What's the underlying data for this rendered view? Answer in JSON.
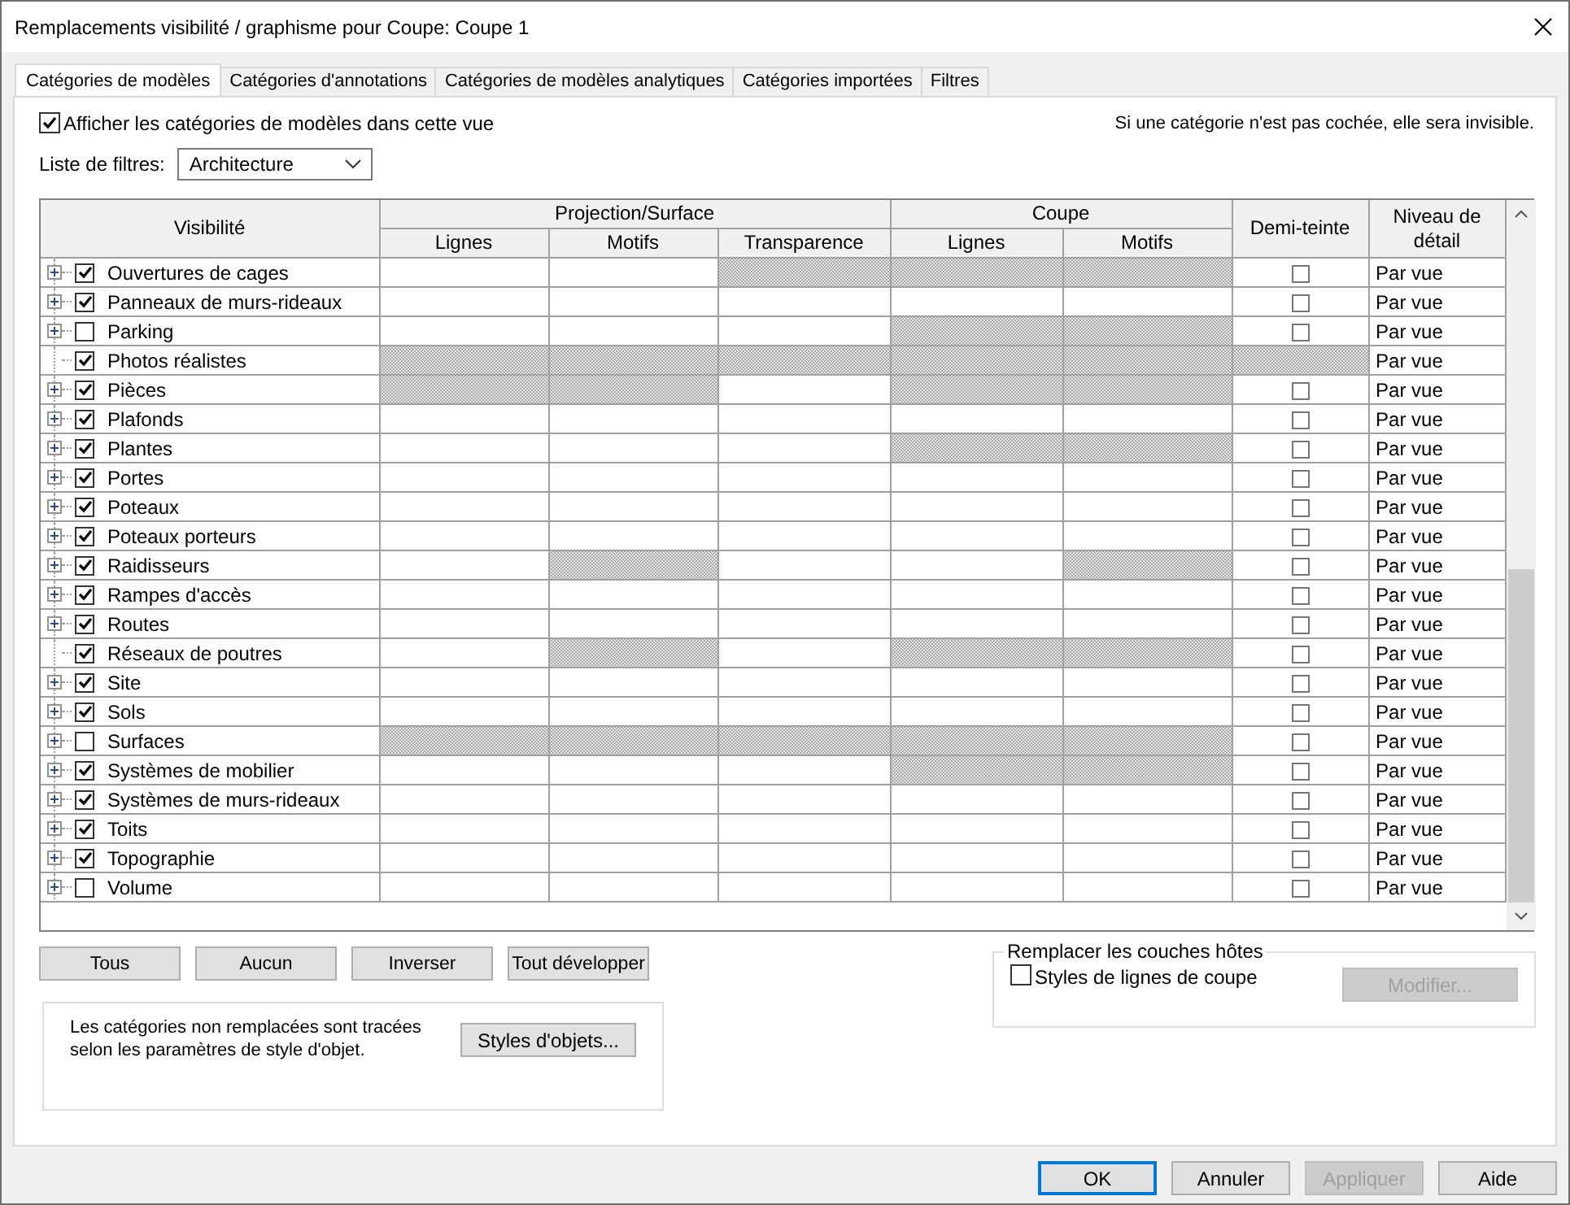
{
  "window": {
    "title": "Remplacements visibilité / graphisme pour Coupe: Coupe 1"
  },
  "tabs": [
    {
      "label": "Catégories de modèles",
      "selected": true
    },
    {
      "label": "Catégories d'annotations",
      "selected": false
    },
    {
      "label": "Catégories de modèles analytiques",
      "selected": false
    },
    {
      "label": "Catégories importées",
      "selected": false
    },
    {
      "label": "Filtres",
      "selected": false
    }
  ],
  "show_categories": {
    "label": "Afficher les catégories de modèles dans cette vue",
    "checked": true
  },
  "hint": "Si une catégorie n'est pas cochée, elle sera invisible.",
  "filter_list": {
    "label": "Liste de filtres:",
    "value": "Architecture"
  },
  "table": {
    "visibility_header": "Visibilité",
    "groups": [
      {
        "label": "Projection/Surface",
        "columns": [
          "Lignes",
          "Motifs",
          "Transparence"
        ]
      },
      {
        "label": "Coupe",
        "columns": [
          "Lignes",
          "Motifs"
        ]
      }
    ],
    "halftone_header": "Demi-teinte",
    "detail_header": "Niveau de détail",
    "rows": [
      {
        "name": "Ouvertures de cages",
        "expanded": false,
        "visible": true,
        "hatched": [
          false,
          false,
          true,
          true,
          true,
          false
        ],
        "halftone": false,
        "detail": "Par vue"
      },
      {
        "name": "Panneaux de murs-rideaux",
        "expanded": false,
        "visible": true,
        "hatched": [
          false,
          false,
          false,
          false,
          false,
          false
        ],
        "halftone": false,
        "detail": "Par vue"
      },
      {
        "name": "Parking",
        "expanded": false,
        "visible": false,
        "hatched": [
          false,
          false,
          false,
          true,
          true,
          false
        ],
        "halftone": false,
        "detail": "Par vue"
      },
      {
        "name": "Photos réalistes",
        "visible": true,
        "hatched": [
          true,
          true,
          true,
          true,
          true,
          true
        ],
        "detail": "Par vue"
      },
      {
        "name": "Pièces",
        "expanded": false,
        "visible": true,
        "hatched": [
          true,
          true,
          false,
          true,
          true,
          false
        ],
        "halftone": false,
        "detail": "Par vue"
      },
      {
        "name": "Plafonds",
        "expanded": false,
        "visible": true,
        "hatched": [
          false,
          false,
          false,
          false,
          false,
          false
        ],
        "halftone": false,
        "detail": "Par vue"
      },
      {
        "name": "Plantes",
        "expanded": false,
        "visible": true,
        "hatched": [
          false,
          false,
          false,
          true,
          true,
          false
        ],
        "halftone": false,
        "detail": "Par vue"
      },
      {
        "name": "Portes",
        "expanded": false,
        "visible": true,
        "hatched": [
          false,
          false,
          false,
          false,
          false,
          false
        ],
        "halftone": false,
        "detail": "Par vue"
      },
      {
        "name": "Poteaux",
        "expanded": false,
        "visible": true,
        "hatched": [
          false,
          false,
          false,
          false,
          false,
          false
        ],
        "halftone": false,
        "detail": "Par vue"
      },
      {
        "name": "Poteaux porteurs",
        "expanded": false,
        "visible": true,
        "hatched": [
          false,
          false,
          false,
          false,
          false,
          false
        ],
        "halftone": false,
        "detail": "Par vue"
      },
      {
        "name": "Raidisseurs",
        "expanded": false,
        "visible": true,
        "hatched": [
          false,
          true,
          false,
          false,
          true,
          false
        ],
        "halftone": false,
        "detail": "Par vue"
      },
      {
        "name": "Rampes d'accès",
        "expanded": false,
        "visible": true,
        "hatched": [
          false,
          false,
          false,
          false,
          false,
          false
        ],
        "halftone": false,
        "detail": "Par vue"
      },
      {
        "name": "Routes",
        "expanded": false,
        "visible": true,
        "hatched": [
          false,
          false,
          false,
          false,
          false,
          false
        ],
        "halftone": false,
        "detail": "Par vue"
      },
      {
        "name": "Réseaux de poutres",
        "visible": true,
        "hatched": [
          false,
          true,
          false,
          true,
          true,
          false
        ],
        "halftone": false,
        "detail": "Par vue"
      },
      {
        "name": "Site",
        "expanded": false,
        "visible": true,
        "hatched": [
          false,
          false,
          false,
          false,
          false,
          false
        ],
        "halftone": false,
        "detail": "Par vue"
      },
      {
        "name": "Sols",
        "expanded": false,
        "visible": true,
        "hatched": [
          false,
          false,
          false,
          false,
          false,
          false
        ],
        "halftone": false,
        "detail": "Par vue"
      },
      {
        "name": "Surfaces",
        "expanded": false,
        "visible": false,
        "hatched": [
          true,
          true,
          true,
          true,
          true,
          false
        ],
        "halftone": false,
        "detail": "Par vue"
      },
      {
        "name": "Systèmes de mobilier",
        "expanded": false,
        "visible": true,
        "hatched": [
          false,
          false,
          false,
          true,
          true,
          false
        ],
        "halftone": false,
        "detail": "Par vue"
      },
      {
        "name": "Systèmes de murs-rideaux",
        "expanded": false,
        "visible": true,
        "hatched": [
          false,
          false,
          false,
          false,
          false,
          false
        ],
        "halftone": false,
        "detail": "Par vue"
      },
      {
        "name": "Toits",
        "expanded": false,
        "visible": true,
        "hatched": [
          false,
          false,
          false,
          false,
          false,
          false
        ],
        "halftone": false,
        "detail": "Par vue"
      },
      {
        "name": "Topographie",
        "expanded": false,
        "visible": true,
        "hatched": [
          false,
          false,
          false,
          false,
          false,
          false
        ],
        "halftone": false,
        "detail": "Par vue"
      },
      {
        "name": "Volume",
        "expanded": false,
        "visible": false,
        "hatched": [
          false,
          false,
          false,
          false,
          false,
          false
        ],
        "halftone": false,
        "detail": "Par vue"
      }
    ]
  },
  "tree_buttons": [
    "Tous",
    "Aucun",
    "Inverser",
    "Tout développer"
  ],
  "note": {
    "text": "Les catégories non remplacées sont tracées selon les paramètres de style d'objet.",
    "button": "Styles d'objets..."
  },
  "host_layers": {
    "title": "Remplacer les couches hôtes",
    "checkbox": {
      "label": "Styles de lignes de coupe",
      "checked": false
    },
    "button": {
      "label": "Modifier...",
      "disabled": true
    }
  },
  "footer_buttons": [
    {
      "label": "OK",
      "default": true,
      "disabled": false
    },
    {
      "label": "Annuler",
      "default": false,
      "disabled": false
    },
    {
      "label": "Appliquer",
      "default": false,
      "disabled": true
    },
    {
      "label": "Aide",
      "default": false,
      "disabled": false
    }
  ]
}
